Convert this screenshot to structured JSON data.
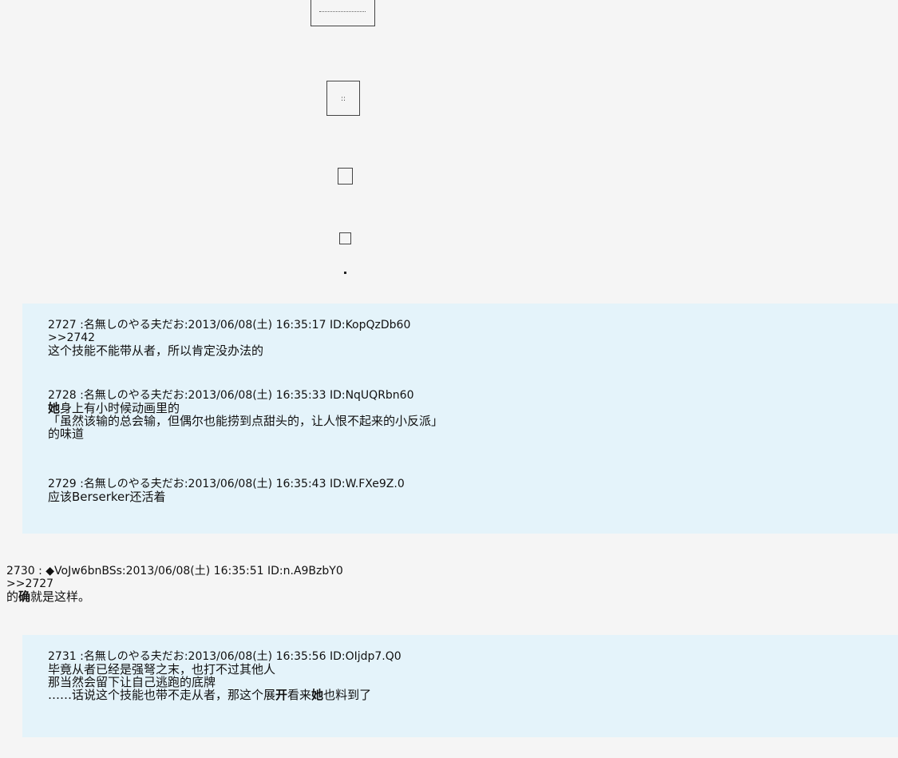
{
  "posts": [
    {
      "number": "2727",
      "name": "名無しのやる夫だお",
      "datetime": "2013/06/08(土) 16:35:17",
      "id": "ID:KopQzDb60",
      "reply_to": ">>2742",
      "lines": [
        "这个技能不能带从者，所以肯定没办法的"
      ]
    },
    {
      "number": "2728",
      "name": "名無しのやる夫だお",
      "datetime": "2013/06/08(土) 16:35:33",
      "id": "ID:NqUQRbn60",
      "bold_prefix": "她",
      "line1_rest": "身上有小时候动画里的",
      "line2": "「虽然该输的总会输，但偶尔也能捞到点甜头的，让人恨不起来的小反派」",
      "line3": "的味道"
    },
    {
      "number": "2729",
      "name": "名無しのやる夫だお",
      "datetime": "2013/06/08(土) 16:35:43",
      "id": "ID:W.FXe9Z.0",
      "lines": [
        "应该Berserker还活着"
      ]
    },
    {
      "number": "2730",
      "name": "◆VoJw6bnBSs",
      "datetime": "2013/06/08(土) 16:35:51",
      "id": "ID:n.A9BzbY0",
      "reply_to": ">>2727",
      "text_before": "的",
      "text_bold": "确",
      "text_after": "就是这样。"
    },
    {
      "number": "2731",
      "name": "名無しのやる夫だお",
      "datetime": "2013/06/08(土) 16:35:56",
      "id": "ID:OIjdp7.Q0",
      "line1": "毕竟从者已经是强弩之末，也打不过其他人",
      "line2": "那当然会留下让自己逃跑的底牌",
      "line3_a": "……话说这个技能也带不走从者，那这个展",
      "line3_b": "开",
      "line3_c": "看来",
      "line3_d": "她",
      "line3_e": "也料到了"
    }
  ]
}
